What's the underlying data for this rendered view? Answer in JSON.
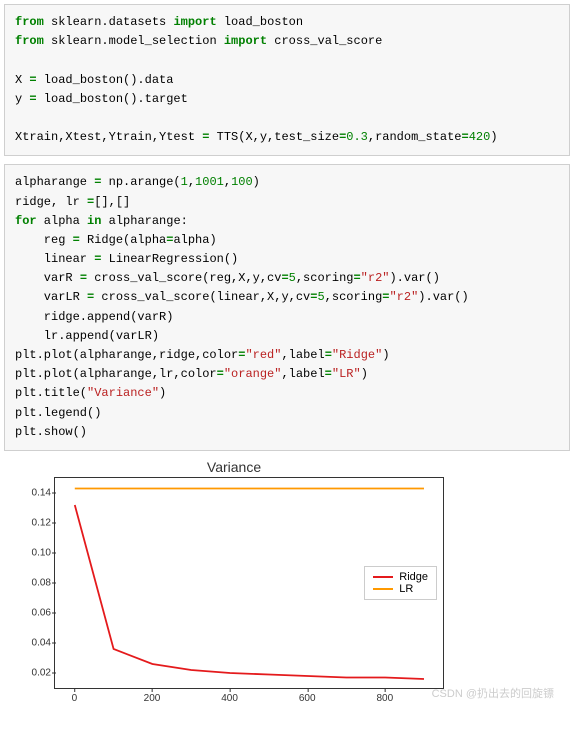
{
  "code1": {
    "l1a": "from",
    "l1b": "sklearn.datasets",
    "l1c": "import",
    "l1d": "load_boston",
    "l2a": "from",
    "l2b": "sklearn.model_selection",
    "l2c": "import",
    "l2d": "cross_val_score",
    "l3a": "X ",
    "l3b": "=",
    "l3c": " load_boston().data",
    "l4a": "y ",
    "l4b": "=",
    "l4c": " load_boston().target",
    "l5a": "Xtrain,Xtest,Ytrain,Ytest ",
    "l5b": "=",
    "l5c": " TTS(X,y,test_size",
    "l5d": "=",
    "l5e": "0.3",
    "l5f": ",random_state",
    "l5g": "=",
    "l5h": "420",
    "l5i": ")"
  },
  "code2": {
    "l1a": "alpharange ",
    "l1b": "=",
    "l1c": " np.arange(",
    "l1d": "1",
    "l1e": ",",
    "l1f": "1001",
    "l1g": ",",
    "l1h": "100",
    "l1i": ")",
    "l2a": "ridge, lr ",
    "l2b": "=",
    "l2c": "[],[]",
    "l3a": "for",
    "l3b": " alpha ",
    "l3c": "in",
    "l3d": " alpharange:",
    "l4a": "    reg ",
    "l4b": "=",
    "l4c": " Ridge(alpha",
    "l4d": "=",
    "l4e": "alpha)",
    "l5a": "    linear ",
    "l5b": "=",
    "l5c": " LinearRegression()",
    "l6a": "    varR ",
    "l6b": "=",
    "l6c": " cross_val_score(reg,X,y,cv",
    "l6d": "=",
    "l6e": "5",
    "l6f": ",scoring",
    "l6g": "=",
    "l6h": "\"r2\"",
    "l6i": ").var()",
    "l7a": "    varLR ",
    "l7b": "=",
    "l7c": " cross_val_score(linear,X,y,cv",
    "l7d": "=",
    "l7e": "5",
    "l7f": ",scoring",
    "l7g": "=",
    "l7h": "\"r2\"",
    "l7i": ").var()",
    "l8": "    ridge.append(varR)",
    "l9": "    lr.append(varLR)",
    "l10a": "plt.plot(alpharange,ridge,color",
    "l10b": "=",
    "l10c": "\"red\"",
    "l10d": ",label",
    "l10e": "=",
    "l10f": "\"Ridge\"",
    "l10g": ")",
    "l11a": "plt.plot(alpharange,lr,color",
    "l11b": "=",
    "l11c": "\"orange\"",
    "l11d": ",label",
    "l11e": "=",
    "l11f": "\"LR\"",
    "l11g": ")",
    "l12a": "plt.title(",
    "l12b": "\"Variance\"",
    "l12c": ")",
    "l13": "plt.legend()",
    "l14": "plt.show()"
  },
  "chart_data": {
    "type": "line",
    "title": "Variance",
    "xlabel": "",
    "ylabel": "",
    "xlim": [
      -50,
      950
    ],
    "ylim": [
      0.01,
      0.15
    ],
    "xticks": [
      0,
      200,
      400,
      600,
      800
    ],
    "yticks": [
      0.02,
      0.04,
      0.06,
      0.08,
      0.1,
      0.12,
      0.14
    ],
    "x": [
      1,
      101,
      201,
      301,
      401,
      501,
      601,
      701,
      801,
      901
    ],
    "series": [
      {
        "name": "Ridge",
        "color": "#e41a1c",
        "values": [
          0.132,
          0.036,
          0.026,
          0.022,
          0.02,
          0.019,
          0.018,
          0.017,
          0.017,
          0.016
        ]
      },
      {
        "name": "LR",
        "color": "#ff9900",
        "values": [
          0.143,
          0.143,
          0.143,
          0.143,
          0.143,
          0.143,
          0.143,
          0.143,
          0.143,
          0.143
        ]
      }
    ],
    "legend_position": "right-middle"
  },
  "watermark": "CSDN @扔出去的回旋镖"
}
